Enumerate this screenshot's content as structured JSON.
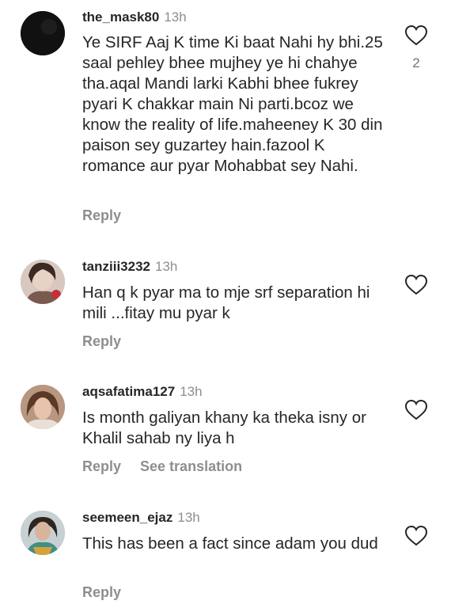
{
  "comments": [
    {
      "username": "the_mask80",
      "time": "13h",
      "text": "Ye SIRF Aaj K time Ki baat Nahi hy bhi.25 saal pehley bhee mujhey ye hi chahye tha.aqal Mandi larki Kabhi bhee fukrey pyari K chakkar main Ni parti.bcoz we know the reality of life.maheeney K 30 din paison sey guzartey hain.fazool K romance aur pyar Mohabbat sey Nahi.",
      "reply": "Reply",
      "likes": "2"
    },
    {
      "username": "tanziii3232",
      "time": "13h",
      "text": "Han q k pyar ma to mje srf separation hi mili ...fitay mu pyar k",
      "reply": "Reply"
    },
    {
      "username": "aqsafatima127",
      "time": "13h",
      "text": "Is month galiyan khany ka theka isny or Khalil sahab ny liya h",
      "reply": "Reply",
      "translate": "See translation"
    },
    {
      "username": "seemeen_ejaz",
      "time": "13h",
      "text": "This has been a fact since adam you dud",
      "reply": "Reply"
    }
  ],
  "icons": {
    "like": "heart-outline-icon"
  },
  "colors": {
    "username": "#262626",
    "secondary": "#8e8e8e"
  }
}
